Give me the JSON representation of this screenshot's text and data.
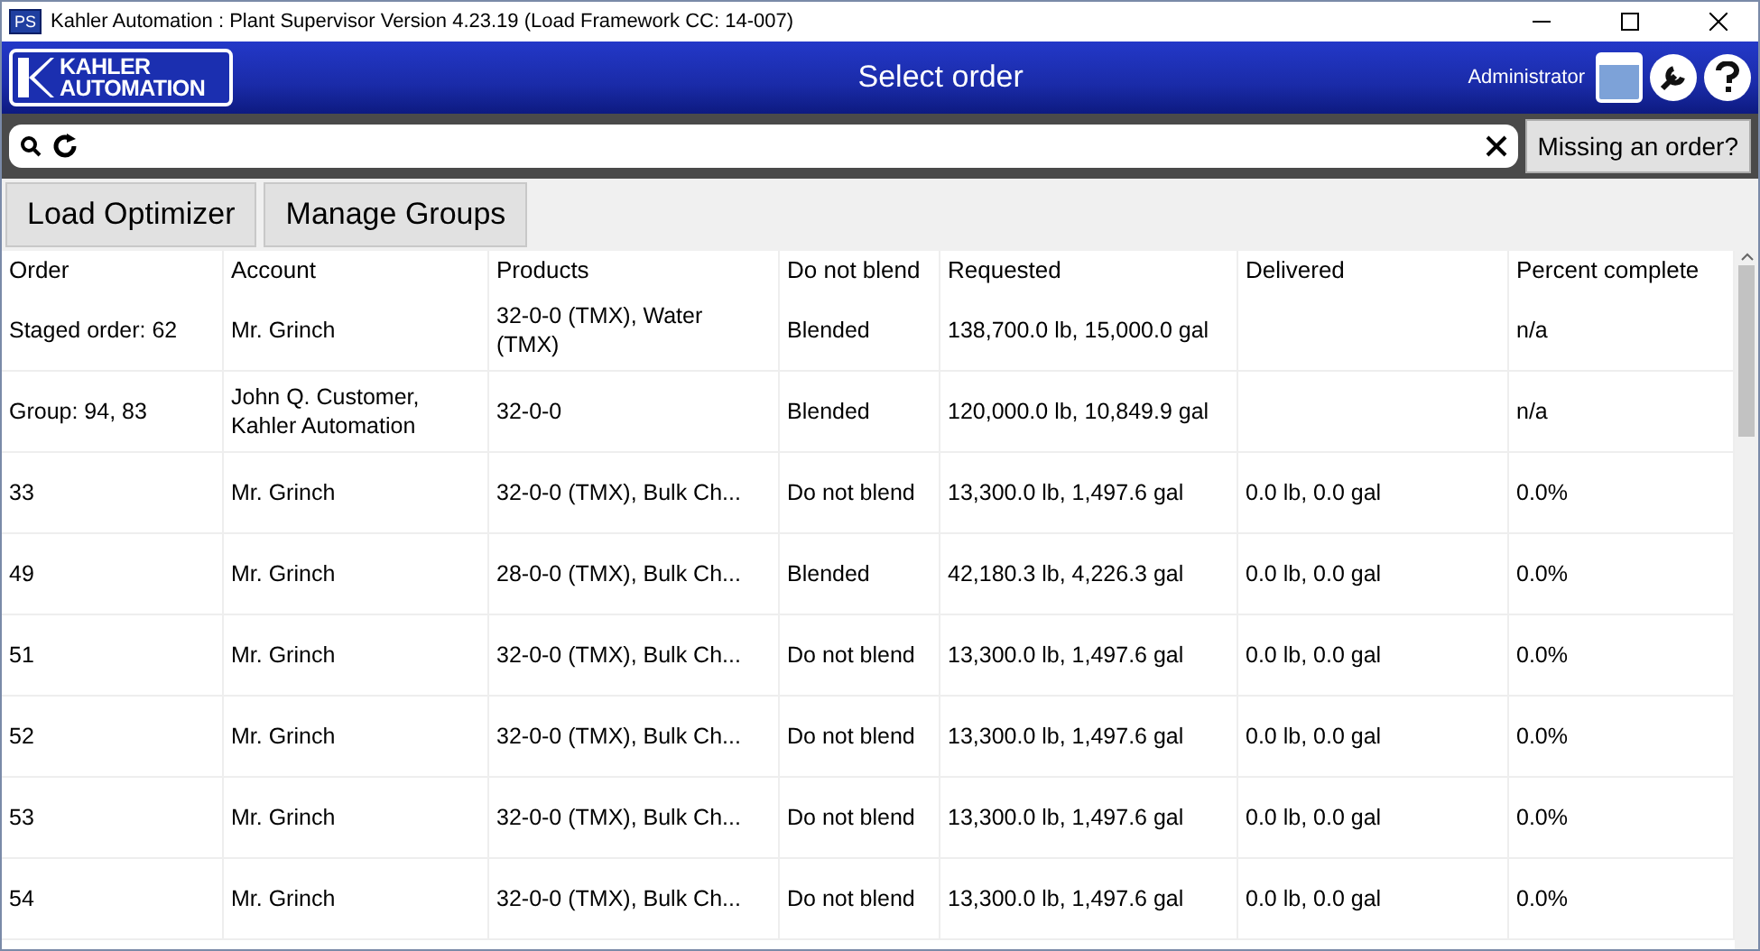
{
  "window": {
    "title": "Kahler Automation : Plant Supervisor Version 4.23.19 (Load Framework CC: 14-007)",
    "app_badge": "PS"
  },
  "header": {
    "logo_top": "KAHLER",
    "logo_bottom": "AUTOMATION",
    "title": "Select order",
    "user": "Administrator"
  },
  "search": {
    "missing_button": "Missing an order?"
  },
  "actions": [
    "Load Optimizer",
    "Manage Groups"
  ],
  "table": {
    "columns": [
      "Order",
      "Account",
      "Products",
      "Do not blend",
      "Requested",
      "Delivered",
      "Percent complete"
    ],
    "rows": [
      [
        "Staged order: 62",
        "Mr. Grinch",
        "32-0-0 (TMX), Water (TMX)",
        "Blended",
        "138,700.0 lb, 15,000.0 gal",
        "",
        "n/a"
      ],
      [
        "Group: 94, 83",
        "John Q. Customer, Kahler Automation",
        "32-0-0",
        "Blended",
        "120,000.0 lb, 10,849.9 gal",
        "",
        "n/a"
      ],
      [
        "33",
        "Mr. Grinch",
        "32-0-0 (TMX), Bulk Ch...",
        "Do not blend",
        "13,300.0 lb, 1,497.6 gal",
        "0.0 lb, 0.0 gal",
        "0.0%"
      ],
      [
        "49",
        "Mr. Grinch",
        "28-0-0 (TMX), Bulk Ch...",
        "Blended",
        "42,180.3 lb, 4,226.3 gal",
        "0.0 lb, 0.0 gal",
        "0.0%"
      ],
      [
        "51",
        "Mr. Grinch",
        "32-0-0 (TMX), Bulk Ch...",
        "Do not blend",
        "13,300.0 lb, 1,497.6 gal",
        "0.0 lb, 0.0 gal",
        "0.0%"
      ],
      [
        "52",
        "Mr. Grinch",
        "32-0-0 (TMX), Bulk Ch...",
        "Do not blend",
        "13,300.0 lb, 1,497.6 gal",
        "0.0 lb, 0.0 gal",
        "0.0%"
      ],
      [
        "53",
        "Mr. Grinch",
        "32-0-0 (TMX), Bulk Ch...",
        "Do not blend",
        "13,300.0 lb, 1,497.6 gal",
        "0.0 lb, 0.0 gal",
        "0.0%"
      ],
      [
        "54",
        "Mr. Grinch",
        "32-0-0 (TMX), Bulk Ch...",
        "Do not blend",
        "13,300.0 lb, 1,497.6 gal",
        "0.0 lb, 0.0 gal",
        "0.0%"
      ]
    ]
  }
}
